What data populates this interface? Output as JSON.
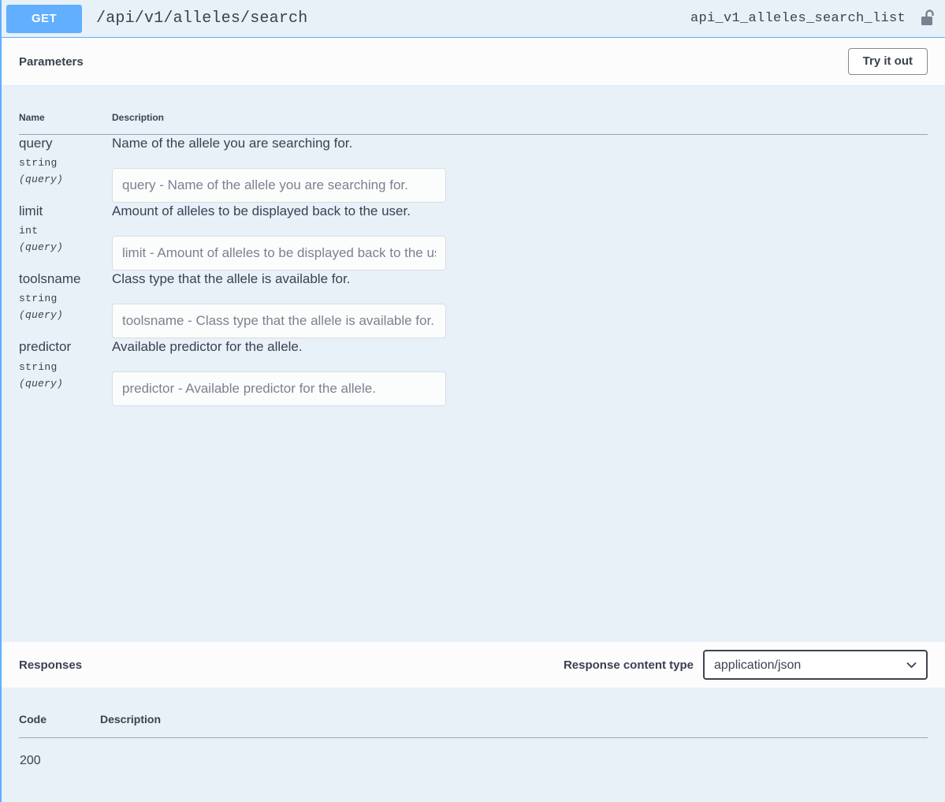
{
  "operation": {
    "method": "GET",
    "path": "/api/v1/alleles/search",
    "operation_id": "api_v1_alleles_search_list",
    "auth_icon": "unlocked-padlock-icon",
    "method_color": "#61affe"
  },
  "parameters_section": {
    "title": "Parameters",
    "try_it_out_label": "Try it out",
    "columns": {
      "name": "Name",
      "description": "Description"
    },
    "items": [
      {
        "name": "query",
        "type": "string",
        "in": "(query)",
        "description": "Name of the allele you are searching for.",
        "placeholder": "query - Name of the allele you are searching for.",
        "value": ""
      },
      {
        "name": "limit",
        "type": "int",
        "in": "(query)",
        "description": "Amount of alleles to be displayed back to the user.",
        "placeholder": "limit - Amount of alleles to be displayed back to the user.",
        "value": ""
      },
      {
        "name": "toolsname",
        "type": "string",
        "in": "(query)",
        "description": "Class type that the allele is available for.",
        "placeholder": "toolsname - Class type that the allele is available for.",
        "value": ""
      },
      {
        "name": "predictor",
        "type": "string",
        "in": "(query)",
        "description": "Available predictor for the allele.",
        "placeholder": "predictor - Available predictor for the allele.",
        "value": ""
      }
    ]
  },
  "responses_section": {
    "title": "Responses",
    "content_type_label": "Response content type",
    "content_type_selected": "application/json",
    "content_type_options": [
      "application/json"
    ],
    "columns": {
      "code": "Code",
      "description": "Description"
    },
    "rows": [
      {
        "code": "200",
        "description": ""
      }
    ]
  }
}
